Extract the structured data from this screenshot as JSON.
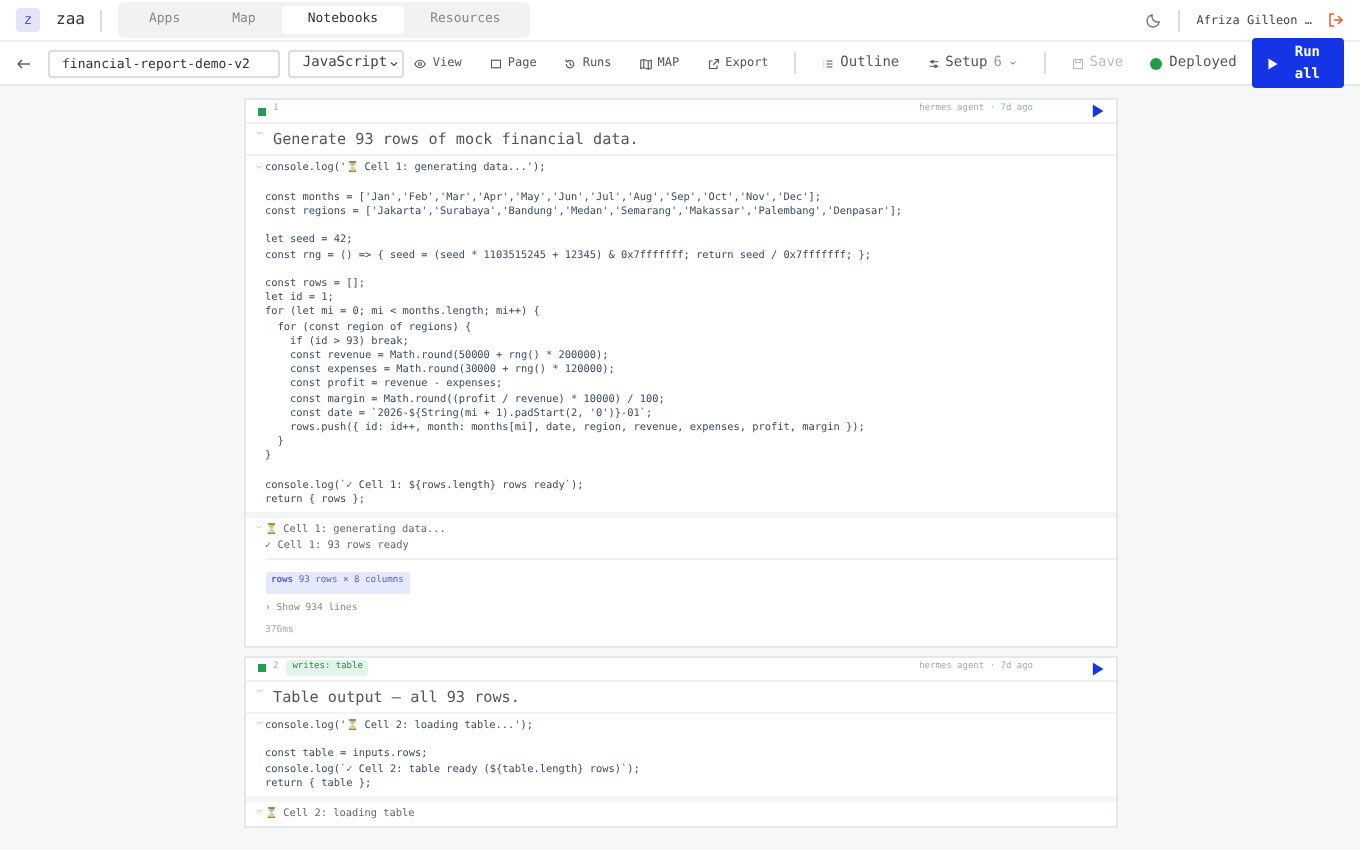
{
  "app": {
    "logo": "z",
    "name": "zaa"
  },
  "nav_tabs": [
    {
      "label": "Apps",
      "selected": false
    },
    {
      "label": "Map",
      "selected": false
    },
    {
      "label": "Notebooks",
      "selected": true
    },
    {
      "label": "Resources",
      "selected": false
    }
  ],
  "user": {
    "name": "Afriza Gilleon …"
  },
  "toolbar": {
    "notebook_name": "financial-report-demo-v2",
    "language": "JavaScript",
    "actions": [
      {
        "label": "View"
      },
      {
        "label": "Page"
      },
      {
        "label": "Runs"
      },
      {
        "label": "MAP"
      },
      {
        "label": "Export"
      }
    ],
    "outline": "Outline",
    "setup": {
      "label": "Setup",
      "count": "6"
    },
    "save": {
      "label": "Save",
      "disabled": true
    },
    "status": {
      "label": "Deployed",
      "color": "#1f9d4c"
    },
    "run_all": "Run all"
  },
  "cells": [
    {
      "number": "1",
      "meta": "hermes agent · 7d ago",
      "markdown": "Generate 93 rows of mock financial data.",
      "code": "console.log('⏳ Cell 1: generating data...');\n\nconst months = ['Jan','Feb','Mar','Apr','May','Jun','Jul','Aug','Sep','Oct','Nov','Dec'];\nconst regions = ['Jakarta','Surabaya','Bandung','Medan','Semarang','Makassar','Palembang','Denpasar'];\n\nlet seed = 42;\nconst rng = () => { seed = (seed * 1103515245 + 12345) & 0x7fffffff; return seed / 0x7fffffff; };\n\nconst rows = [];\nlet id = 1;\nfor (let mi = 0; mi < months.length; mi++) {\n  for (const region of regions) {\n    if (id > 93) break;\n    const revenue = Math.round(50000 + rng() * 200000);\n    const expenses = Math.round(30000 + rng() * 120000);\n    const profit = revenue - expenses;\n    const margin = Math.round((profit / revenue) * 10000) / 100;\n    const date = `2026-${String(mi + 1).padStart(2, '0')}-01`;\n    rows.push({ id: id++, month: months[mi], date, region, revenue, expenses, profit, margin });\n  }\n}\n\nconsole.log(`✓ Cell 1: ${rows.length} rows ready`);\nreturn { rows };",
      "logs": [
        "⏳ Cell 1: generating data...",
        "✓ Cell 1: 93 rows ready"
      ],
      "result": {
        "name": "rows",
        "summary": "93 rows × 8 columns"
      },
      "show_lines": "› Show 934 lines",
      "duration": "376ms"
    },
    {
      "number": "2",
      "tag": "writes: table",
      "meta": "hermes agent · 7d ago",
      "markdown": "Table output — all 93 rows.",
      "code": "console.log('⏳ Cell 2: loading table...');\n\nconst table = inputs.rows;\nconsole.log(`✓ Cell 2: table ready (${table.length} rows)`);\nreturn { table };",
      "logs": [
        "⏳ Cell 2: loading table"
      ]
    }
  ]
}
